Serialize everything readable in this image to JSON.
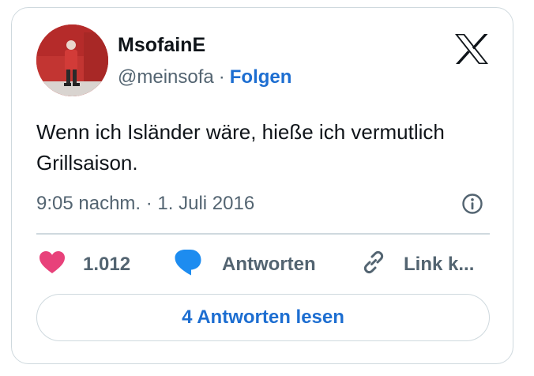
{
  "author": {
    "display_name": "MsofainE",
    "handle": "@meinsofa",
    "separator": "·",
    "follow_label": "Folgen"
  },
  "tweet": {
    "text": "Wenn ich Isländer wäre, hieße ich vermutlich Grillsaison.",
    "timestamp": "9:05 nachm. · 1. Juli 2016"
  },
  "actions": {
    "like_count": "1.012",
    "reply_label": "Antworten",
    "link_label": "Link k..."
  },
  "read_replies_label": "4 Antworten lesen",
  "icons": {
    "logo": "x-logo-icon",
    "info": "info-icon",
    "like": "heart-icon",
    "reply": "speech-bubble-icon",
    "link": "link-icon"
  },
  "colors": {
    "accent": "#1d6ed1",
    "heart": "#e8417a",
    "reply_bubble": "#1d8cf0",
    "border": "#cfd9de",
    "secondary_text": "#536471"
  }
}
